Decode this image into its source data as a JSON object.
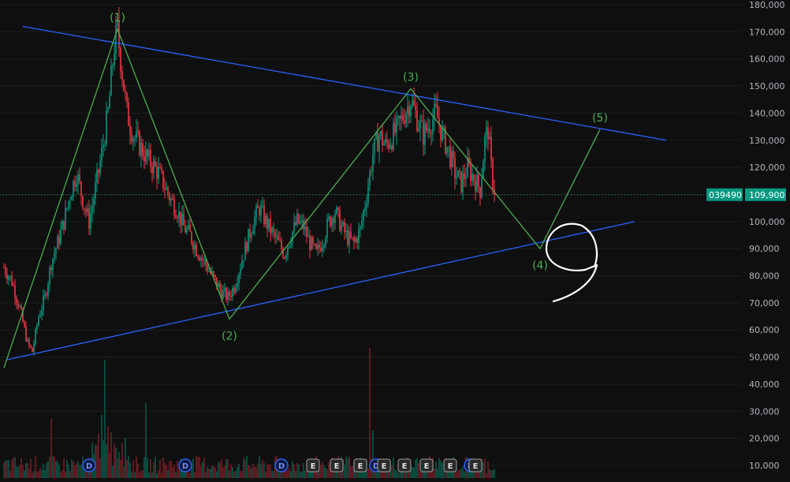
{
  "chart_data": {
    "type": "candlestick",
    "y_axis": {
      "side": "right",
      "range": [
        4000,
        180000
      ],
      "ticks": [
        {
          "value": 180000,
          "label": "180,000"
        },
        {
          "value": 170000,
          "label": "170,000"
        },
        {
          "value": 160000,
          "label": "160,000"
        },
        {
          "value": 150000,
          "label": "150,000"
        },
        {
          "value": 140000,
          "label": "140,000"
        },
        {
          "value": 130000,
          "label": "130,000"
        },
        {
          "value": 120000,
          "label": "120,000"
        },
        {
          "value": 110000,
          "label": "110,000"
        },
        {
          "value": 100000,
          "label": "100,000"
        },
        {
          "value": 90000,
          "label": "90,000"
        },
        {
          "value": 80000,
          "label": "80,000"
        },
        {
          "value": 70000,
          "label": "70,000"
        },
        {
          "value": 60000,
          "label": "60,000"
        },
        {
          "value": 50000,
          "label": "50,000"
        },
        {
          "value": 40000,
          "label": "40,000"
        },
        {
          "value": 30000,
          "label": "30,000"
        },
        {
          "value": 20000,
          "label": "20,000"
        },
        {
          "value": 10000,
          "label": "10,000"
        }
      ]
    },
    "price_path": [
      [
        0,
        83000
      ],
      [
        5,
        78000
      ],
      [
        10,
        68000
      ],
      [
        15,
        55000
      ],
      [
        18,
        52000
      ],
      [
        22,
        65000
      ],
      [
        26,
        72000
      ],
      [
        30,
        85000
      ],
      [
        34,
        92000
      ],
      [
        38,
        100000
      ],
      [
        42,
        110000
      ],
      [
        46,
        118000
      ],
      [
        50,
        108000
      ],
      [
        54,
        100000
      ],
      [
        58,
        112000
      ],
      [
        62,
        125000
      ],
      [
        66,
        140000
      ],
      [
        70,
        165000
      ],
      [
        72,
        170000
      ],
      [
        75,
        155000
      ],
      [
        78,
        140000
      ],
      [
        82,
        132000
      ],
      [
        86,
        128000
      ],
      [
        90,
        124000
      ],
      [
        94,
        121000
      ],
      [
        98,
        118000
      ],
      [
        102,
        113000
      ],
      [
        106,
        108000
      ],
      [
        110,
        104000
      ],
      [
        114,
        98000
      ],
      [
        118,
        95000
      ],
      [
        122,
        90000
      ],
      [
        126,
        86000
      ],
      [
        130,
        82000
      ],
      [
        134,
        78000
      ],
      [
        138,
        74000
      ],
      [
        142,
        72000
      ],
      [
        146,
        76000
      ],
      [
        150,
        84000
      ],
      [
        154,
        92000
      ],
      [
        158,
        100000
      ],
      [
        162,
        105000
      ],
      [
        166,
        100000
      ],
      [
        170,
        96000
      ],
      [
        174,
        92000
      ],
      [
        178,
        88000
      ],
      [
        182,
        95000
      ],
      [
        186,
        100000
      ],
      [
        190,
        98000
      ],
      [
        194,
        92000
      ],
      [
        198,
        88000
      ],
      [
        202,
        93000
      ],
      [
        206,
        100000
      ],
      [
        210,
        104000
      ],
      [
        214,
        98000
      ],
      [
        218,
        94000
      ],
      [
        222,
        92000
      ],
      [
        226,
        97000
      ],
      [
        230,
        110000
      ],
      [
        234,
        125000
      ],
      [
        238,
        132000
      ],
      [
        242,
        128000
      ],
      [
        246,
        131000
      ],
      [
        250,
        135000
      ],
      [
        254,
        140000
      ],
      [
        258,
        145000
      ],
      [
        262,
        138000
      ],
      [
        266,
        132000
      ],
      [
        270,
        136000
      ],
      [
        274,
        140000
      ],
      [
        278,
        132000
      ],
      [
        282,
        126000
      ],
      [
        286,
        118000
      ],
      [
        290,
        114000
      ],
      [
        294,
        120000
      ],
      [
        298,
        116000
      ],
      [
        302,
        112000
      ],
      [
        305,
        130000
      ],
      [
        307,
        134000
      ],
      [
        309,
        120000
      ],
      [
        311,
        109900
      ]
    ],
    "wave_path": [
      {
        "label": "",
        "time": 0,
        "value": 46000
      },
      {
        "label": "(1)",
        "time": 72,
        "value": 171000
      },
      {
        "label": "(2)",
        "time": 143,
        "value": 64000
      },
      {
        "label": "(3)",
        "time": 258,
        "value": 149000
      },
      {
        "label": "(4)",
        "time": 340,
        "value": 90000
      },
      {
        "label": "(5)",
        "time": 378,
        "value": 134000
      }
    ],
    "trend_lines": [
      {
        "color": "#2962ff",
        "from": {
          "time": 12,
          "value": 172000
        },
        "to": {
          "time": 420,
          "value": 130000
        }
      },
      {
        "color": "#2962ff",
        "from": {
          "time": 2,
          "value": 49000
        },
        "to": {
          "time": 400,
          "value": 100000
        }
      }
    ],
    "price_markers": [
      {
        "value": 109900,
        "label": "109,900",
        "color": "#089981"
      },
      {
        "value": 109900,
        "label": "039490",
        "color": "#089981"
      }
    ],
    "events": [
      {
        "label": "D",
        "time": 54,
        "color": "#2962ff"
      },
      {
        "label": "D",
        "time": 115,
        "color": "#2962ff"
      },
      {
        "label": "D",
        "time": 176,
        "color": "#2962ff"
      },
      {
        "label": "E",
        "time": 196,
        "color": "#9e9e9e"
      },
      {
        "label": "E",
        "time": 211,
        "color": "#9e9e9e"
      },
      {
        "label": "E",
        "time": 226,
        "color": "#9e9e9e"
      },
      {
        "label": "D",
        "time": 236,
        "color": "#2962ff"
      },
      {
        "label": "E",
        "time": 241,
        "color": "#9e9e9e"
      },
      {
        "label": "E",
        "time": 254,
        "color": "#9e9e9e"
      },
      {
        "label": "E",
        "time": 268,
        "color": "#9e9e9e"
      },
      {
        "label": "E",
        "time": 283,
        "color": "#9e9e9e"
      },
      {
        "label": "D",
        "time": 296,
        "color": "#2962ff"
      },
      {
        "label": "E",
        "time": 299,
        "color": "#9e9e9e"
      }
    ],
    "colors": {
      "up": "#089981",
      "down": "#f23645",
      "wave": "#4caf50",
      "grid": "#1e1e1e",
      "background": "#0f0f0f"
    }
  }
}
